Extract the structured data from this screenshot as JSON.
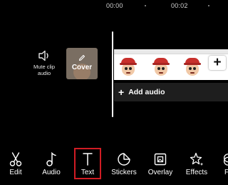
{
  "timeline": {
    "ruler": [
      "00:00",
      "00:02"
    ],
    "mute": {
      "label": "Mute clip audio",
      "icon": "speaker-icon"
    },
    "cover": {
      "label": "Cover",
      "icon": "pencil-icon"
    },
    "add_clip": {
      "label": "+"
    },
    "add_audio": {
      "plus": "+",
      "label": "Add audio"
    }
  },
  "toolbar": {
    "highlighted": "Text",
    "items": [
      {
        "label": "Edit",
        "icon": "scissors-icon"
      },
      {
        "label": "Audio",
        "icon": "music-note-icon"
      },
      {
        "label": "Text",
        "icon": "text-t-icon"
      },
      {
        "label": "Stickers",
        "icon": "sticker-icon"
      },
      {
        "label": "Overlay",
        "icon": "overlay-icon"
      },
      {
        "label": "Effects",
        "icon": "effects-star-icon"
      },
      {
        "label": "F",
        "icon": "filters-icon"
      }
    ]
  },
  "colors": {
    "highlight": "#d01c24",
    "background": "#000000"
  }
}
